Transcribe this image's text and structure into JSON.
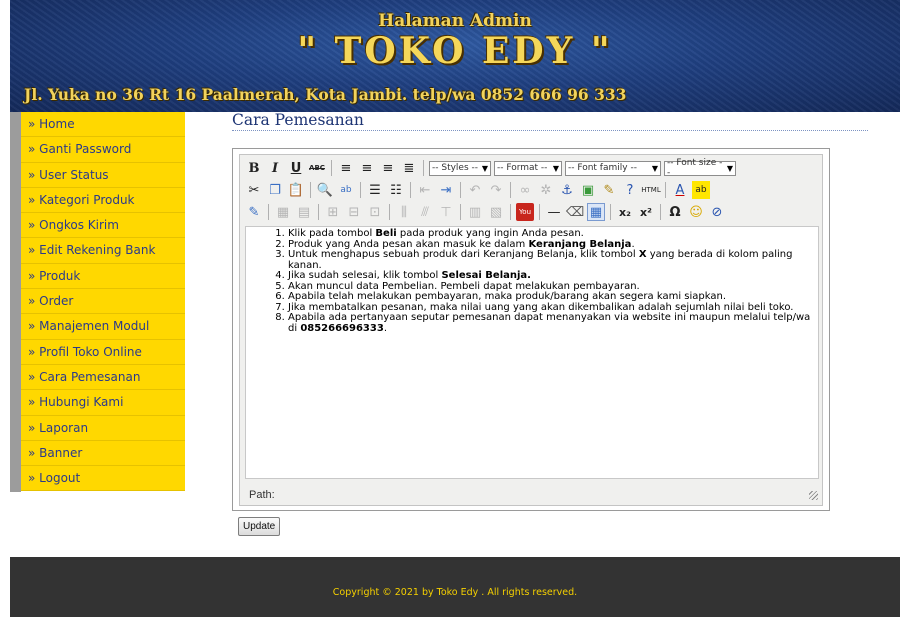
{
  "header": {
    "line1": "Halaman Admin",
    "line2": "\" TOKO EDY \"",
    "line3": "Jl. Yuka no 36 Rt 16 Paalmerah, Kota Jambi. telp/wa 0852 666 96 333"
  },
  "sidebar": {
    "items": [
      {
        "label": "» Home"
      },
      {
        "label": "» Ganti Password"
      },
      {
        "label": "» User Status"
      },
      {
        "label": "» Kategori Produk"
      },
      {
        "label": "» Ongkos Kirim"
      },
      {
        "label": "» Edit Rekening Bank"
      },
      {
        "label": "» Produk"
      },
      {
        "label": "» Order"
      },
      {
        "label": "» Manajemen Modul"
      },
      {
        "label": "» Profil Toko Online"
      },
      {
        "label": "» Cara Pemesanan"
      },
      {
        "label": "» Hubungi Kami"
      },
      {
        "label": "» Laporan"
      },
      {
        "label": "» Banner"
      },
      {
        "label": "» Logout"
      }
    ]
  },
  "main": {
    "title": "Cara Pemesanan"
  },
  "editor": {
    "toolbar": {
      "styles": "-- Styles --",
      "format": "-- Format --",
      "font_family": "-- Font family --",
      "font_size": "-- Font size --"
    },
    "content": {
      "item1_pre": "Klik pada tombol ",
      "item1_bold": "Beli",
      "item1_post": " pada produk yang ingin Anda pesan.",
      "item2_pre": "Produk yang Anda pesan akan masuk ke dalam ",
      "item2_bold": "Keranjang Belanja",
      "item2_post": ".",
      "item3_pre": "Untuk menghapus sebuah produk dari Keranjang Belanja, klik tombol ",
      "item3_bold": "X",
      "item3_post": " yang berada di kolom paling kanan.",
      "item4_pre": "Jika sudah selesai, klik tombol ",
      "item4_bold": "Selesai Belanja.",
      "item5": "Akan muncul data Pembelian. Pembeli dapat melakukan pembayaran.",
      "item6": "Apabila telah melakukan pembayaran, maka produk/barang akan segera kami siapkan.",
      "item7": "Jika membatalkan pesanan, maka nilai uang yang akan dikembalikan adalah sejumlah nilai beli toko.",
      "item8_pre": "Apabila ada pertanyaan seputar pemesanan dapat menanyakan via website ini maupun melalui telp/wa di ",
      "item8_bold": "085266696333",
      "item8_post": "."
    },
    "status_path": "Path:"
  },
  "actions": {
    "update_label": "Update"
  },
  "footer": {
    "text": "Copyright © 2021 by Toko Edy . All rights reserved."
  },
  "colors": {
    "nav_bg": "#ffd800",
    "nav_text": "#2b3a8a",
    "footer_bg": "#333333",
    "footer_text": "#f5d000",
    "title_text": "#1e3574"
  }
}
